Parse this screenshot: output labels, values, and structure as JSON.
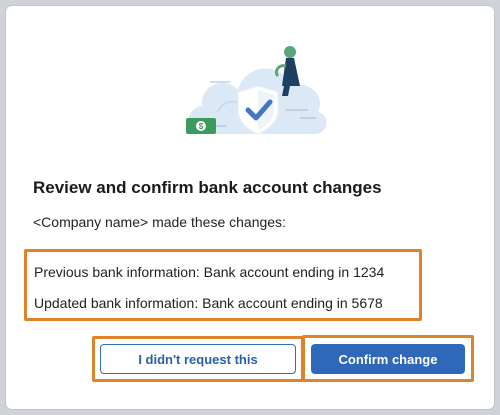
{
  "dialog": {
    "title": "Review and confirm bank account changes",
    "subtitle": "<Company name> made these changes:",
    "previous_info": "Previous bank information: Bank account ending in 1234",
    "updated_info": "Updated bank information: Bank account ending in 5678",
    "secondary_button": "I didn't request this",
    "primary_button": "Confirm change"
  },
  "illustration": {
    "icons": [
      "cloud-icon",
      "shield-check-icon",
      "dollar-bill-icon",
      "person-icon"
    ]
  },
  "colors": {
    "primary": "#2f68b8",
    "highlight": "#e0822c",
    "cloud": "#dbe8f6",
    "bill": "#3c9a5f"
  }
}
